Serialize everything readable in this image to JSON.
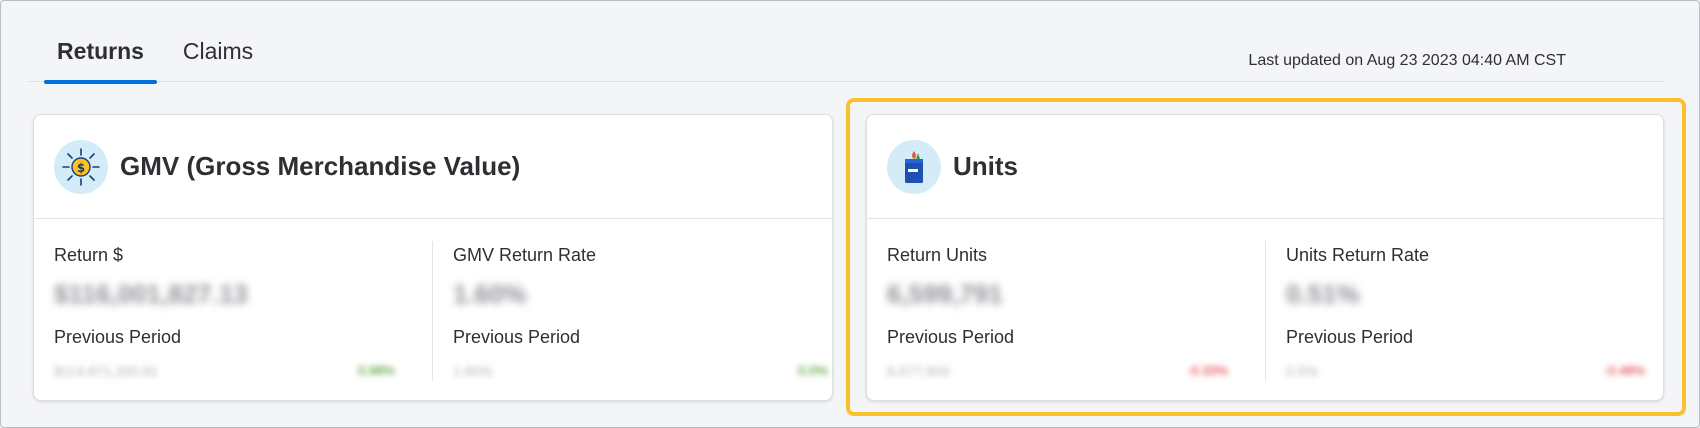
{
  "tabs": [
    {
      "label": "Returns",
      "active": true
    },
    {
      "label": "Claims",
      "active": false
    }
  ],
  "last_updated": "Last updated on Aug 23 2023 04:40 AM CST",
  "colors": {
    "accent": "#0071dc",
    "highlight": "#fcbf2e",
    "positive": "#2a8703",
    "negative": "#de1c24"
  },
  "cards": [
    {
      "title": "GMV (Gross Merchandise Value)",
      "icon": "dollar-sun-icon",
      "metrics": [
        {
          "label": "Return $",
          "value": "$116,001,827.13",
          "prev_label": "Previous Period",
          "prev_value": "$114,871,330.91",
          "delta": "0.98%",
          "trend": "up"
        },
        {
          "label": "GMV Return Rate",
          "value": "1.60%",
          "prev_label": "Previous Period",
          "prev_value": "1.60%",
          "delta": "0.0%",
          "trend": "up"
        }
      ]
    },
    {
      "title": "Units",
      "icon": "shopping-bag-icon",
      "metrics": [
        {
          "label": "Return Units",
          "value": "6,599,791",
          "prev_label": "Previous Period",
          "prev_value": "6,577,903",
          "delta": "-0.33%",
          "trend": "down"
        },
        {
          "label": "Units Return Rate",
          "value": "0.51%",
          "prev_label": "Previous Period",
          "prev_value": "0.5%",
          "delta": "-0.48%",
          "trend": "down"
        }
      ]
    }
  ]
}
